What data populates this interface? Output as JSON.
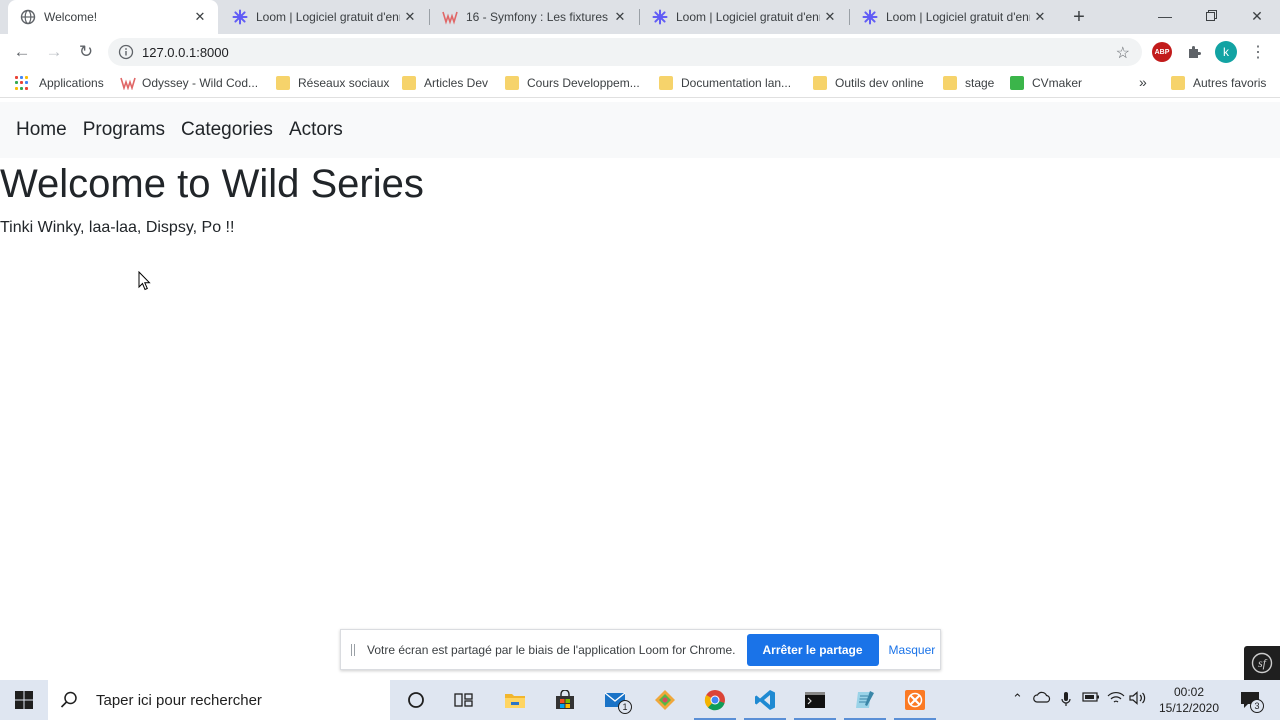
{
  "browser": {
    "tabs": [
      {
        "title": "Welcome!",
        "active": true
      },
      {
        "title": "Loom | Logiciel gratuit d'enregistrement",
        "active": false
      },
      {
        "title": "16 - Symfony : Les fixtures",
        "active": false
      },
      {
        "title": "Loom | Logiciel gratuit d'enregistrement",
        "active": false
      },
      {
        "title": "Loom | Logiciel gratuit d'enregistrement",
        "active": false
      }
    ],
    "new_tab_icon": "plus-icon",
    "url": "127.0.0.1:8000",
    "profile_initial": "k",
    "abp_label": "ABP",
    "bookmarks": [
      {
        "label": "Applications",
        "icon": "apps-grid-icon"
      },
      {
        "label": "Odyssey - Wild Cod...",
        "icon": "wild-code-icon"
      },
      {
        "label": "Réseaux sociaux",
        "icon": "folder-icon"
      },
      {
        "label": "Articles Dev",
        "icon": "folder-icon"
      },
      {
        "label": "Cours Developpem...",
        "icon": "folder-icon"
      },
      {
        "label": "Documentation lan...",
        "icon": "folder-icon"
      },
      {
        "label": "Outils dev online",
        "icon": "folder-icon"
      },
      {
        "label": "stage",
        "icon": "folder-icon"
      },
      {
        "label": "CVmaker",
        "icon": "cv-icon"
      }
    ],
    "bookmarks_overflow": "»",
    "other_bookmarks": "Autres favoris"
  },
  "page": {
    "nav": [
      "Home",
      "Programs",
      "Categories",
      "Actors"
    ],
    "title": "Welcome to Wild Series",
    "subtitle": "Tinki Winky, laa-laa, Dispsy, Po !!"
  },
  "loom_banner": {
    "message": "Votre écran est partagé par le biais de l'application Loom for Chrome.",
    "stop_label": "Arrêter le partage",
    "hide_label": "Masquer"
  },
  "taskbar": {
    "search_placeholder": "Taper ici pour rechercher",
    "mail_badge": "1",
    "time": "00:02",
    "date": "15/12/2020",
    "notification_count": "3"
  },
  "colors": {
    "accent_blue": "#1a73e8",
    "tab_strip": "#dee1e6",
    "page_nav_bg": "#f8f9fa",
    "taskbar_bg": "#dfe6f1"
  }
}
